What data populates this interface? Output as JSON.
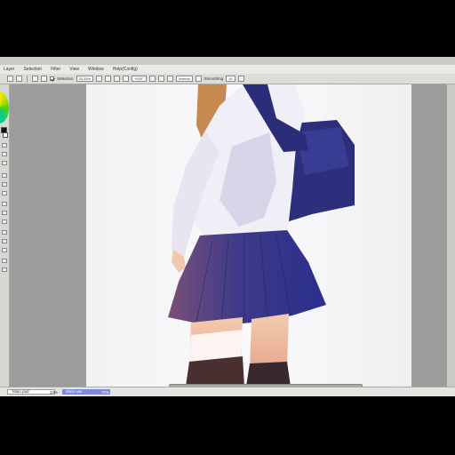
{
  "menu": {
    "items": [
      "Layer",
      "Selection",
      "Filter",
      "View",
      "Window",
      "Help(Config)"
    ]
  },
  "toolbar": {
    "selection_label": "Selection",
    "zoom_value": "33.33%",
    "rotation_value": "+000°",
    "blend_mode": "Normal",
    "smoothing_label": "Smoothing",
    "smoothing_value": "15"
  },
  "status": {
    "navigator_label": "Main pad",
    "zoom_pct": "33%",
    "memory_label": "Mem use",
    "memory_pct": "70%"
  },
  "colors": {
    "foreground": "#111111",
    "background": "#ffffff",
    "memory_bar": "#7f88de"
  },
  "canvas": {
    "subject": "anime schoolgirl illustration in sailor uniform with navy skirt and shoulder bag"
  }
}
